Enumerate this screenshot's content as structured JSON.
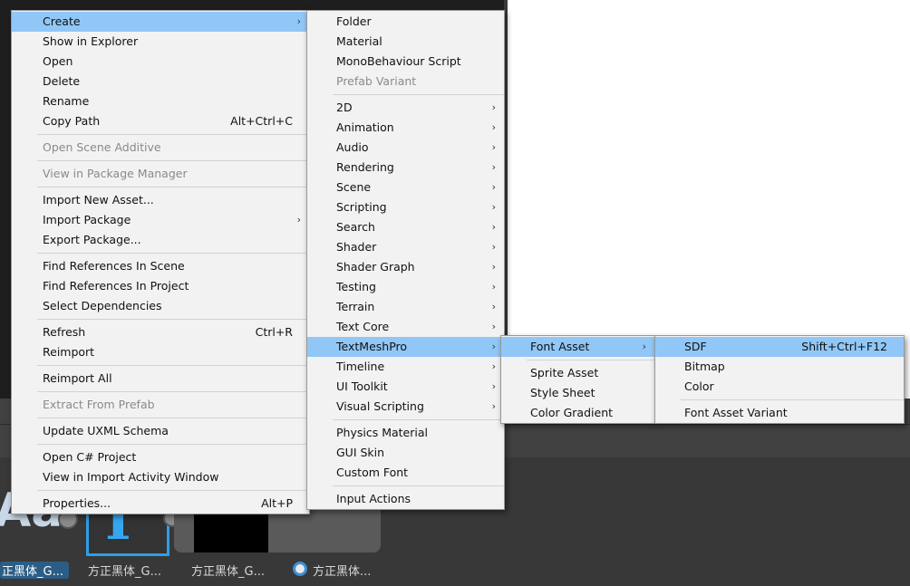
{
  "main_menu": {
    "items": [
      {
        "type": "item",
        "label": "Create",
        "submenu": true,
        "highlight": true
      },
      {
        "type": "item",
        "label": "Show in Explorer"
      },
      {
        "type": "item",
        "label": "Open"
      },
      {
        "type": "item",
        "label": "Delete"
      },
      {
        "type": "item",
        "label": "Rename"
      },
      {
        "type": "item",
        "label": "Copy Path",
        "shortcut": "Alt+Ctrl+C"
      },
      {
        "type": "sep"
      },
      {
        "type": "item",
        "label": "Open Scene Additive",
        "disabled": true
      },
      {
        "type": "sep"
      },
      {
        "type": "item",
        "label": "View in Package Manager",
        "disabled": true
      },
      {
        "type": "sep"
      },
      {
        "type": "item",
        "label": "Import New Asset..."
      },
      {
        "type": "item",
        "label": "Import Package",
        "submenu": true
      },
      {
        "type": "item",
        "label": "Export Package..."
      },
      {
        "type": "sep"
      },
      {
        "type": "item",
        "label": "Find References In Scene"
      },
      {
        "type": "item",
        "label": "Find References In Project"
      },
      {
        "type": "item",
        "label": "Select Dependencies"
      },
      {
        "type": "sep"
      },
      {
        "type": "item",
        "label": "Refresh",
        "shortcut": "Ctrl+R"
      },
      {
        "type": "item",
        "label": "Reimport"
      },
      {
        "type": "sep"
      },
      {
        "type": "item",
        "label": "Reimport All"
      },
      {
        "type": "sep"
      },
      {
        "type": "item",
        "label": "Extract From Prefab",
        "disabled": true
      },
      {
        "type": "sep"
      },
      {
        "type": "item",
        "label": "Update UXML Schema"
      },
      {
        "type": "sep"
      },
      {
        "type": "item",
        "label": "Open C# Project"
      },
      {
        "type": "item",
        "label": "View in Import Activity Window"
      },
      {
        "type": "sep"
      },
      {
        "type": "item",
        "label": "Properties...",
        "shortcut": "Alt+P"
      }
    ]
  },
  "create_menu": {
    "items": [
      {
        "type": "item",
        "label": "Folder"
      },
      {
        "type": "item",
        "label": "Material"
      },
      {
        "type": "item",
        "label": "MonoBehaviour Script"
      },
      {
        "type": "item",
        "label": "Prefab Variant",
        "disabled": true
      },
      {
        "type": "sep"
      },
      {
        "type": "item",
        "label": "2D",
        "submenu": true
      },
      {
        "type": "item",
        "label": "Animation",
        "submenu": true
      },
      {
        "type": "item",
        "label": "Audio",
        "submenu": true
      },
      {
        "type": "item",
        "label": "Rendering",
        "submenu": true
      },
      {
        "type": "item",
        "label": "Scene",
        "submenu": true
      },
      {
        "type": "item",
        "label": "Scripting",
        "submenu": true
      },
      {
        "type": "item",
        "label": "Search",
        "submenu": true
      },
      {
        "type": "item",
        "label": "Shader",
        "submenu": true
      },
      {
        "type": "item",
        "label": "Shader Graph",
        "submenu": true
      },
      {
        "type": "item",
        "label": "Testing",
        "submenu": true
      },
      {
        "type": "item",
        "label": "Terrain",
        "submenu": true
      },
      {
        "type": "item",
        "label": "Text Core",
        "submenu": true
      },
      {
        "type": "item",
        "label": "TextMeshPro",
        "submenu": true,
        "highlight": true
      },
      {
        "type": "item",
        "label": "Timeline",
        "submenu": true
      },
      {
        "type": "item",
        "label": "UI Toolkit",
        "submenu": true
      },
      {
        "type": "item",
        "label": "Visual Scripting",
        "submenu": true
      },
      {
        "type": "sep"
      },
      {
        "type": "item",
        "label": "Physics Material"
      },
      {
        "type": "item",
        "label": "GUI Skin"
      },
      {
        "type": "item",
        "label": "Custom Font"
      },
      {
        "type": "sep"
      },
      {
        "type": "item",
        "label": "Input Actions"
      }
    ]
  },
  "textmeshpro_menu": {
    "items": [
      {
        "type": "item",
        "label": "Font Asset",
        "submenu": true,
        "highlight": true
      },
      {
        "type": "sep"
      },
      {
        "type": "item",
        "label": "Sprite Asset"
      },
      {
        "type": "item",
        "label": "Style Sheet"
      },
      {
        "type": "item",
        "label": "Color Gradient"
      }
    ]
  },
  "font_asset_menu": {
    "items": [
      {
        "type": "item",
        "label": "SDF",
        "shortcut": "Shift+Ctrl+F12",
        "highlight": true
      },
      {
        "type": "item",
        "label": "Bitmap"
      },
      {
        "type": "item",
        "label": "Color"
      },
      {
        "type": "sep"
      },
      {
        "type": "item",
        "label": "Font Asset Variant"
      }
    ]
  },
  "assets": {
    "aa_glyph": "Aa",
    "t_glyph": "T",
    "labels": [
      "正黑体_G...",
      "方正黑体_G...",
      "方正黑体_G...",
      "方正黑体..."
    ]
  },
  "icons": {
    "submenu_arrow": "›"
  },
  "colors": {
    "menu_bg": "#f2f2f2",
    "highlight": "#90c7f7",
    "disabled_text": "#8a8a8a",
    "selection_blue": "#2f9de8"
  }
}
